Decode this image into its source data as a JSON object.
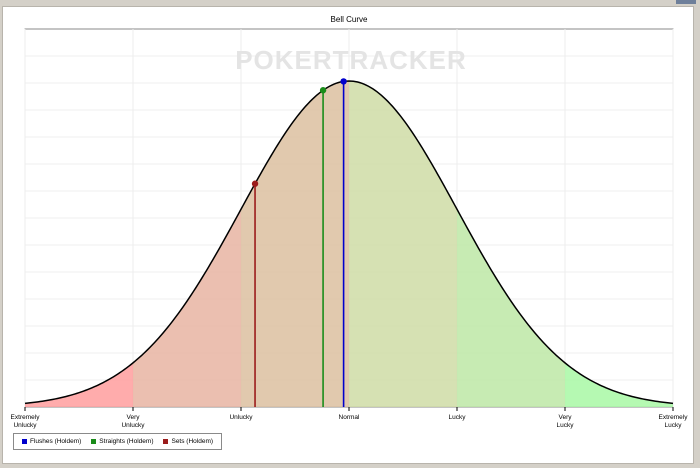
{
  "chart_data": {
    "type": "line",
    "title": "Bell Curve",
    "watermark": "POKERTRACKER",
    "categories": [
      "Extremely\nUnlucky",
      "Very\nUnlucky",
      "Unlucky",
      "Normal",
      "Lucky",
      "Very\nLucky",
      "Extremely\nLucky"
    ],
    "x_range": [
      -3,
      3
    ],
    "curve": {
      "type": "normal",
      "mean": 0,
      "sd": 1
    },
    "zones": [
      {
        "from": -3,
        "to": -2,
        "color": "#ff9e9e"
      },
      {
        "from": -2,
        "to": -1,
        "color": "#e8b4a2"
      },
      {
        "from": -1,
        "to": 0,
        "color": "#dcc0a0"
      },
      {
        "from": 0,
        "to": 1,
        "color": "#cfdca6"
      },
      {
        "from": 1,
        "to": 2,
        "color": "#bde8a6"
      },
      {
        "from": 2,
        "to": 3,
        "color": "#a8f8a4"
      }
    ],
    "grid": true,
    "legend_position": "bottom-left",
    "series": [
      {
        "name": "Flushes (Holdem)",
        "x": -0.05,
        "color": "#0000cc"
      },
      {
        "name": "Straights (Holdem)",
        "x": -0.24,
        "color": "#1a8c1a"
      },
      {
        "name": "Sets (Holdem)",
        "x": -0.87,
        "color": "#9b1c1c"
      }
    ]
  }
}
